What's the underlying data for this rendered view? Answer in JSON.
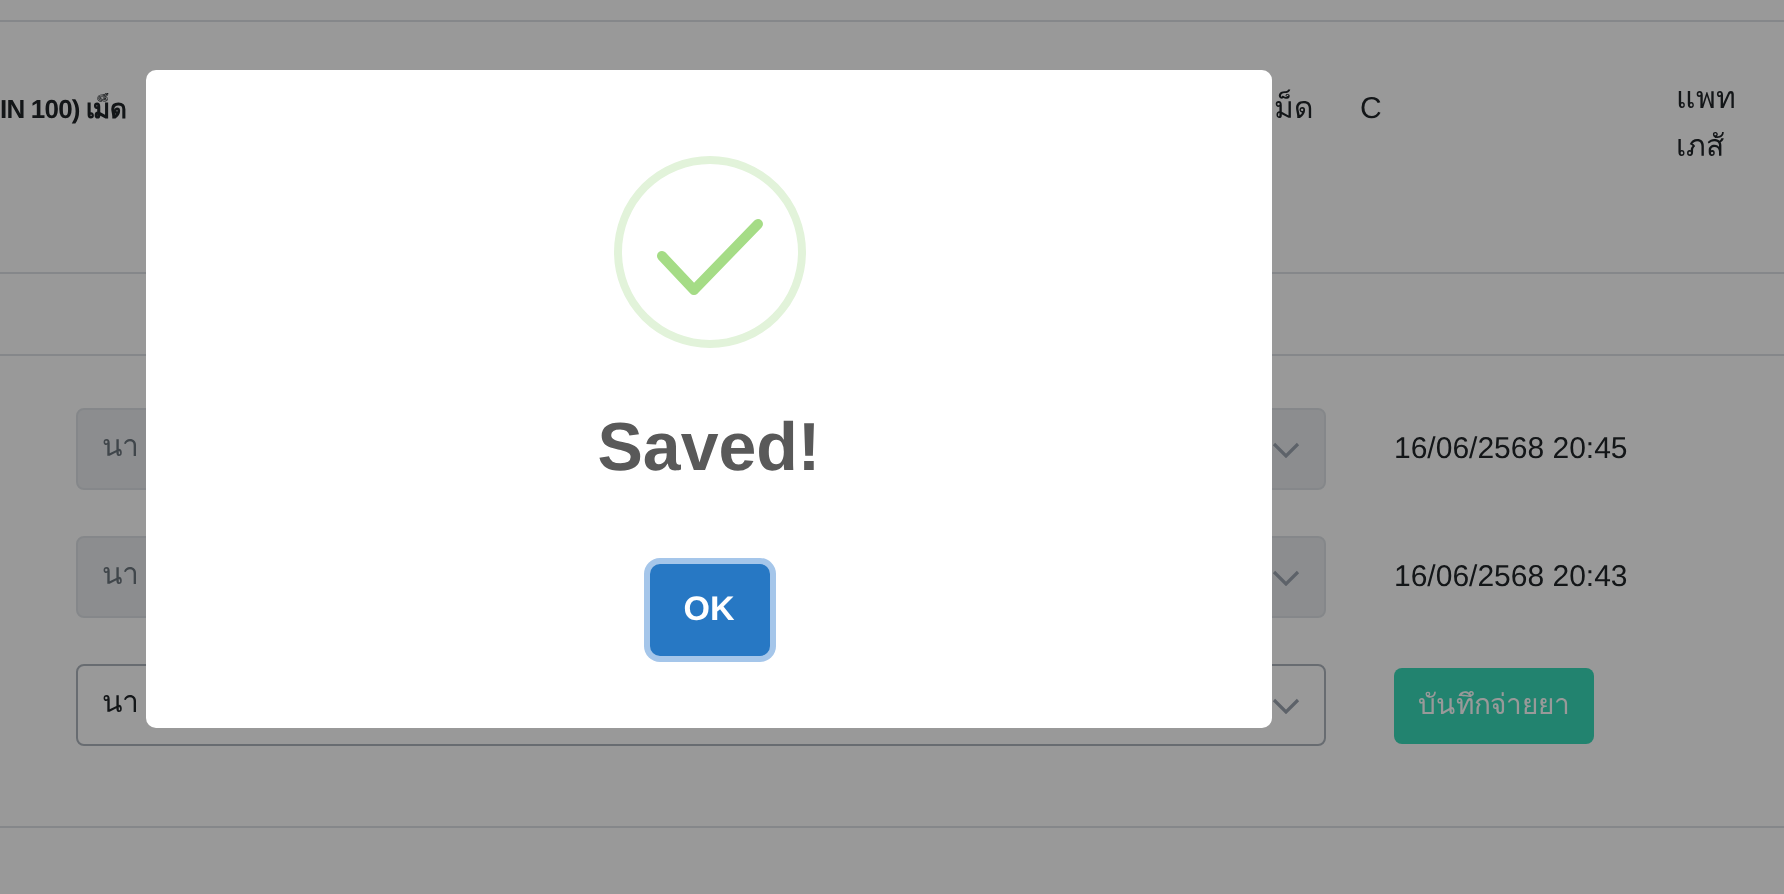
{
  "table_row": {
    "column_1": "IN 100) เม็ด",
    "column_2": "ม็ด",
    "column_3": "C",
    "column_4": [
      "แพท",
      "เภสั"
    ]
  },
  "dispense_rows": [
    {
      "kind": "record",
      "select_value": "นา",
      "disabled": true,
      "time": "16/06/2568 20:45"
    },
    {
      "kind": "record",
      "select_value": "นา",
      "disabled": true,
      "time": "16/06/2568 20:43"
    },
    {
      "kind": "action",
      "select_value": "นา",
      "disabled": false,
      "button": "บันทึกจ่ายยา"
    }
  ],
  "dialog": {
    "kind": "success",
    "title": "Saved!",
    "confirm_button": "OK"
  }
}
